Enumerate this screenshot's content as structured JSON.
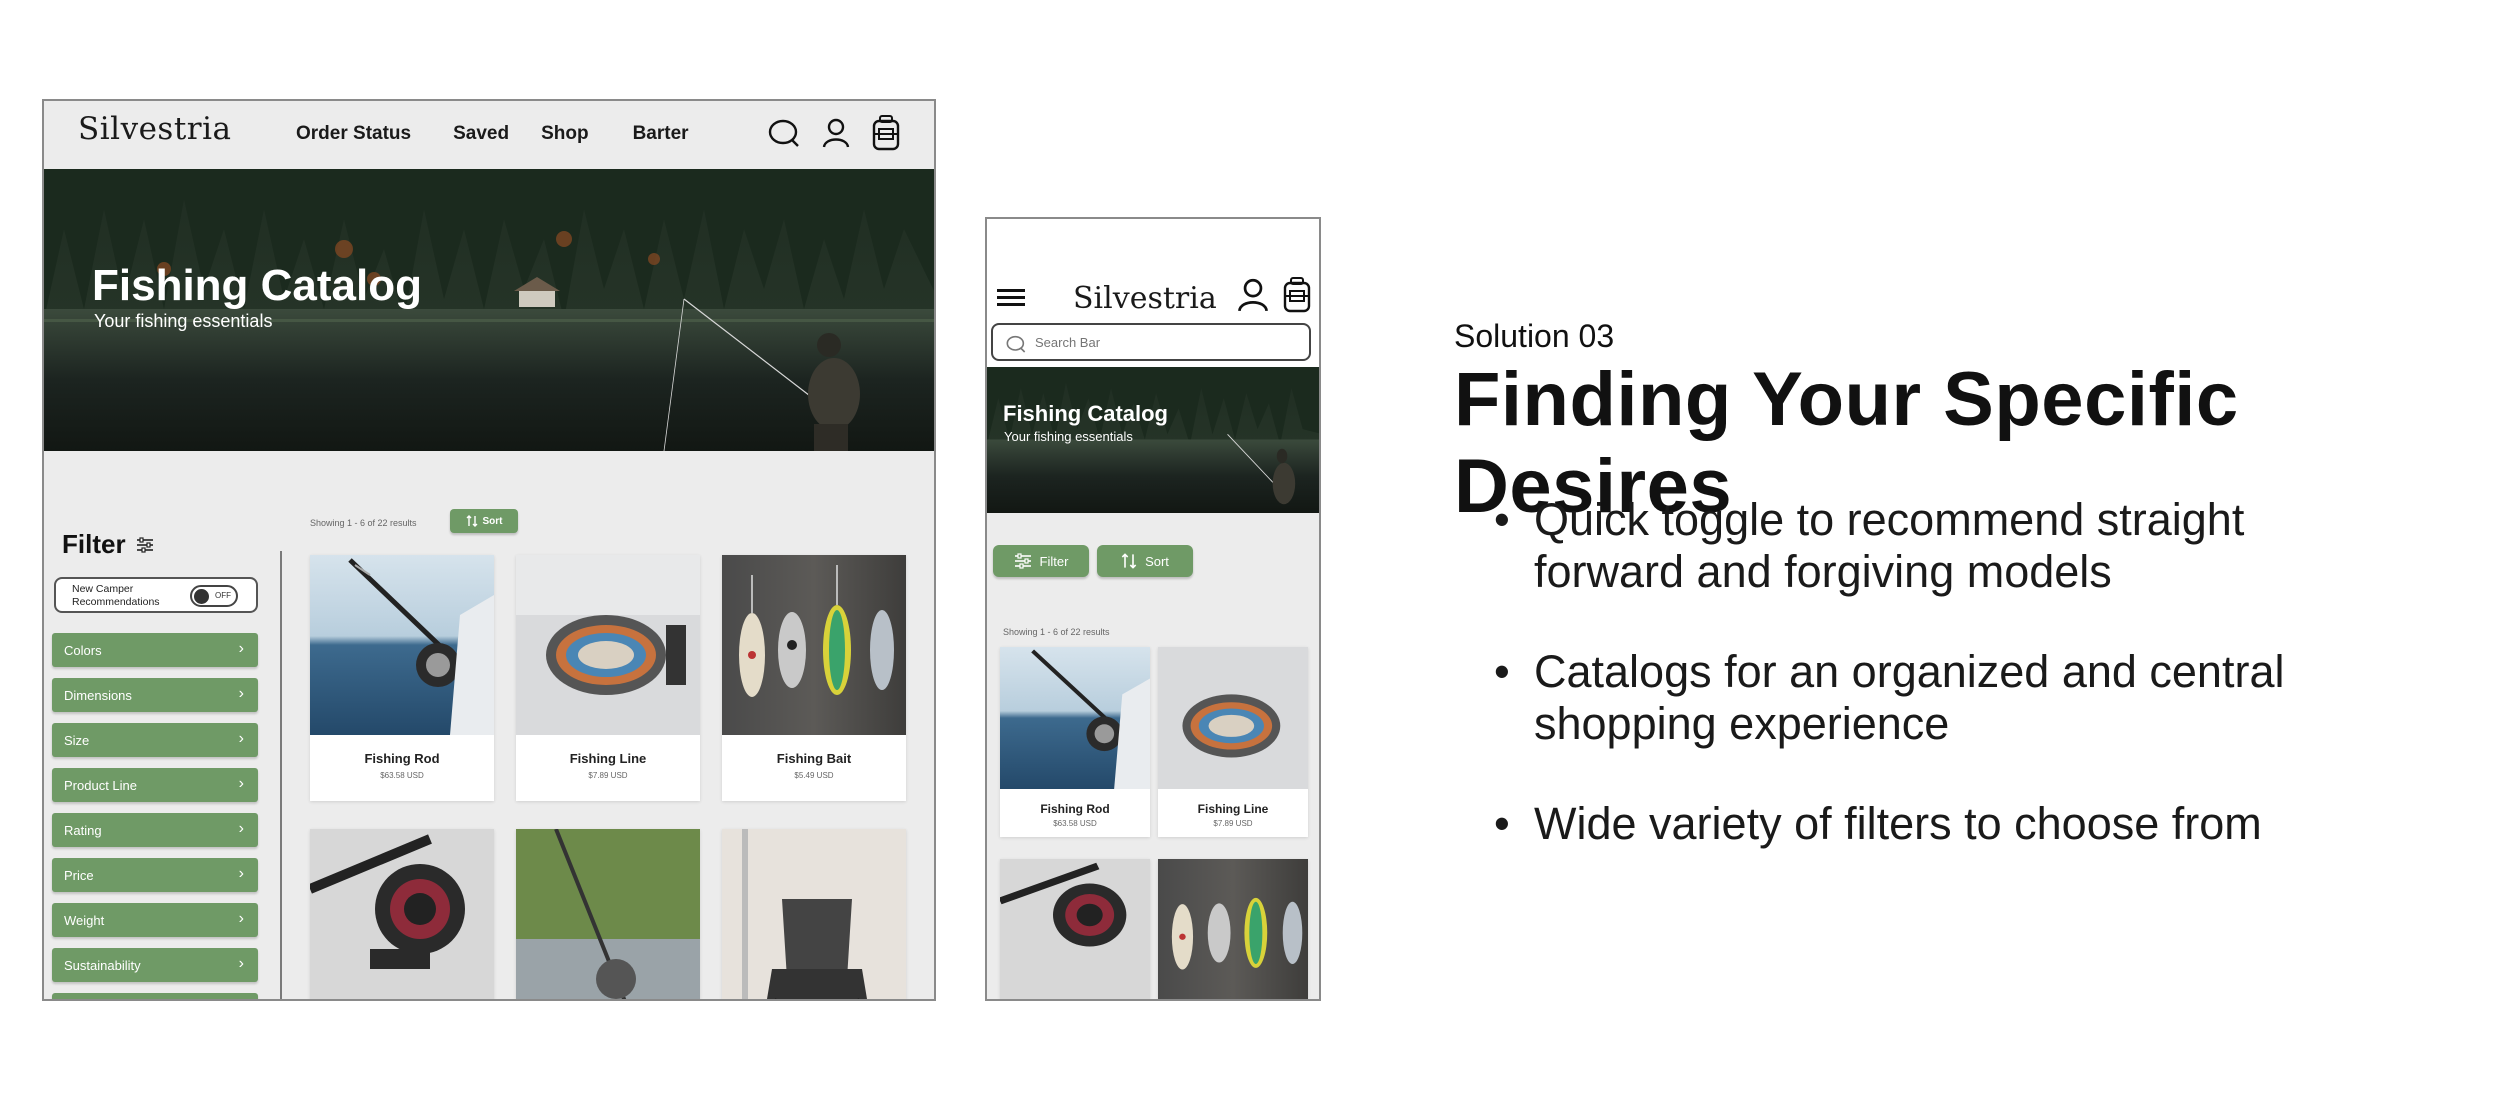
{
  "brand": "Silvestria",
  "desktop": {
    "nav_links": [
      "Order Status",
      "Saved",
      "Shop",
      "Barter"
    ],
    "hero_title": "Fishing Catalog",
    "hero_subtitle": "Your fishing essentials",
    "filter_title": "Filter",
    "toggle_label": "New Camper Recommendations",
    "toggle_state": "OFF",
    "filters": [
      "Colors",
      "Dimensions",
      "Size",
      "Product Line",
      "Rating",
      "Price",
      "Weight",
      "Sustainability"
    ],
    "results_text": "Showing 1 - 6 of 22 results",
    "sort_label": "Sort",
    "products": [
      {
        "name": "Fishing Rod",
        "price": "$63.58 USD"
      },
      {
        "name": "Fishing Line",
        "price": "$7.89 USD"
      },
      {
        "name": "Fishing Bait",
        "price": "$5.49 USD"
      }
    ]
  },
  "mobile": {
    "search_placeholder": "Search Bar",
    "hero_title": "Fishing Catalog",
    "hero_subtitle": "Your fishing essentials",
    "filter_label": "Filter",
    "sort_label": "Sort",
    "results_text": "Showing 1 - 6 of 22 results",
    "products": [
      {
        "name": "Fishing Rod",
        "price": "$63.58 USD"
      },
      {
        "name": "Fishing Line",
        "price": "$7.89 USD"
      }
    ]
  },
  "solution": {
    "label": "Solution 03",
    "title": "Finding Your Specific Desires",
    "bullets": [
      "Quick toggle to recommend straight forward and forgiving models",
      "Catalogs for an organized and central shopping experience",
      "Wide variety of filters to choose from"
    ]
  },
  "colors": {
    "accent_green": "#6f9a66",
    "panel_bg": "#ececec"
  }
}
